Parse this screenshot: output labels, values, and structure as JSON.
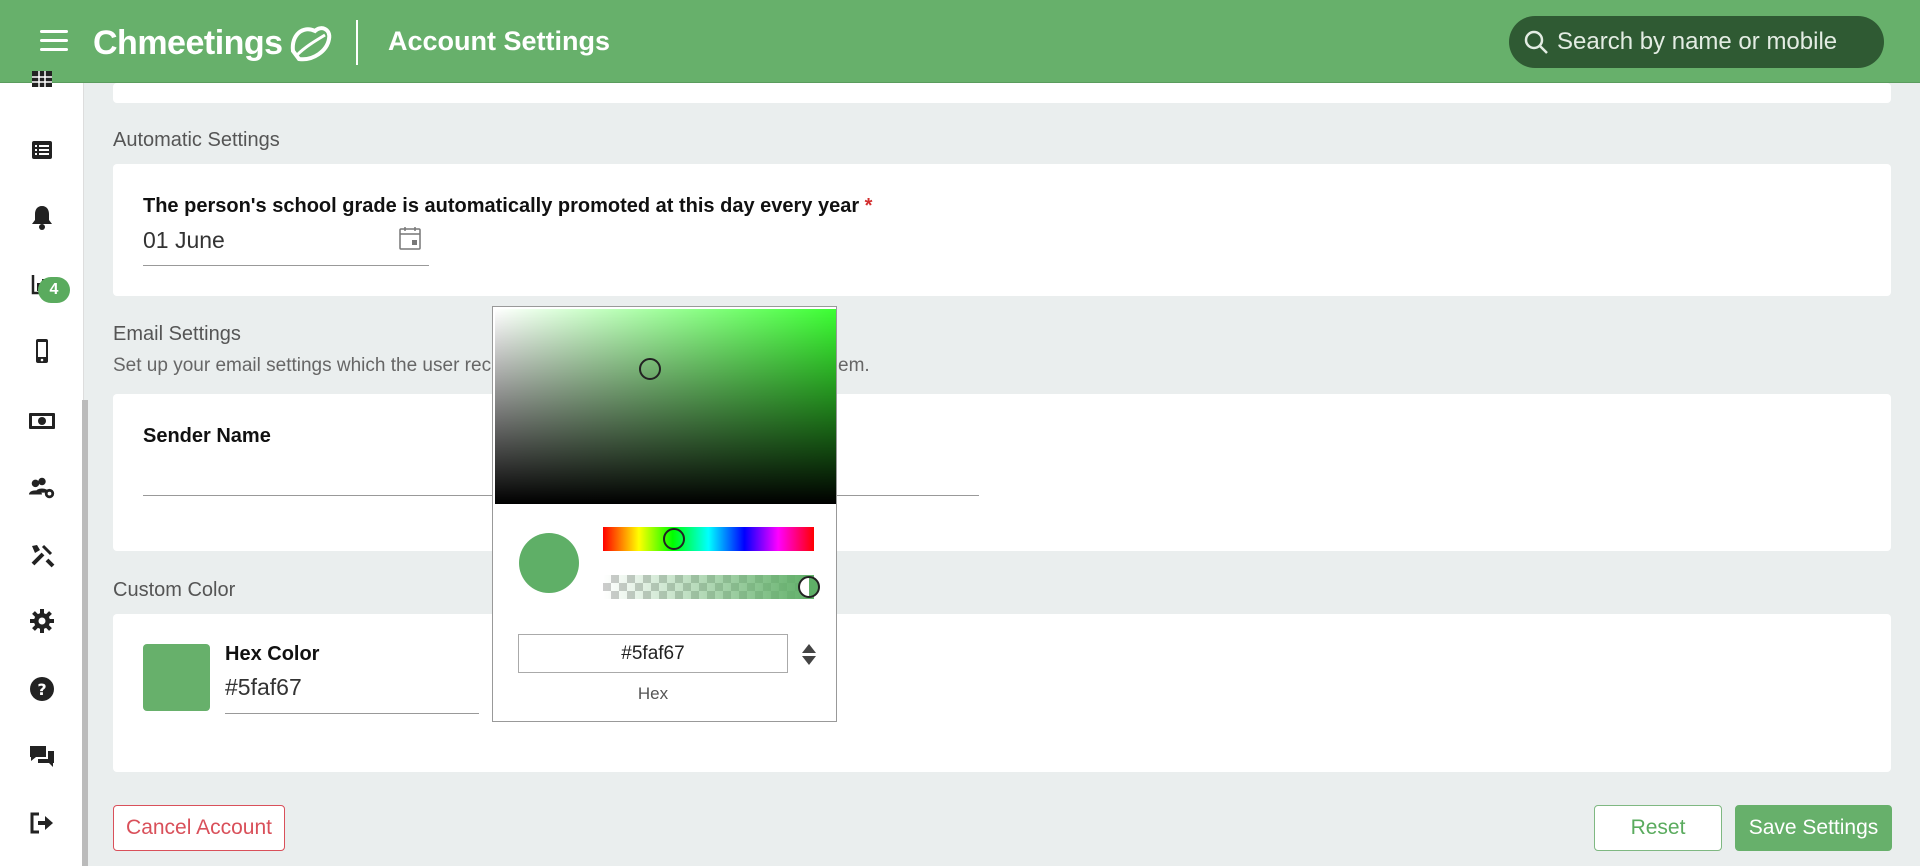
{
  "header": {
    "brand": "Chmeetings",
    "title": "Account Settings",
    "search_placeholder": "Search by name or mobile"
  },
  "sidebar": {
    "items": [
      {
        "icon": "table-icon"
      },
      {
        "icon": "list-icon"
      },
      {
        "icon": "bell-icon",
        "badge": "4"
      },
      {
        "icon": "bar-chart-icon"
      },
      {
        "icon": "mobile-icon"
      },
      {
        "icon": "money-icon"
      },
      {
        "icon": "users-gear-icon"
      },
      {
        "icon": "tools-icon"
      },
      {
        "icon": "gear-icon"
      },
      {
        "icon": "help-icon"
      },
      {
        "icon": "chat-icon"
      },
      {
        "icon": "logout-icon"
      }
    ]
  },
  "automatic": {
    "title": "Automatic Settings",
    "grade_label": "The person's school grade is automatically promoted at this day every year",
    "required_mark": "*",
    "grade_date": "01 June"
  },
  "email": {
    "title": "Email Settings",
    "subtitle_left": "Set up your email settings which the user rec",
    "subtitle_right": "em.",
    "sender_label": "Sender Name",
    "sender_value": ""
  },
  "custom_color": {
    "title": "Custom Color",
    "hex_label": "Hex Color",
    "hex_value": "#5faf67",
    "swatch_color": "#67b06b"
  },
  "color_picker": {
    "hex_value": "#5faf67",
    "mode_label": "Hex",
    "alpha": 1.0
  },
  "actions": {
    "cancel_label": "Cancel Account",
    "reset_label": "Reset",
    "save_label": "Save Settings"
  },
  "colors": {
    "brand_green": "#67b06b",
    "danger": "#d9505a"
  }
}
